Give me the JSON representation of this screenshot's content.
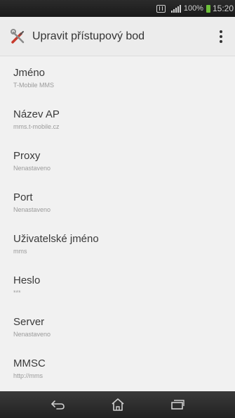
{
  "status_bar": {
    "battery_percent": "100%",
    "time": "15:20"
  },
  "action_bar": {
    "title": "Upravit přístupový bod"
  },
  "settings": [
    {
      "title": "Jméno",
      "value": "T-Mobile MMS"
    },
    {
      "title": "Název AP",
      "value": "mms.t-mobile.cz"
    },
    {
      "title": "Proxy",
      "value": "Nenastaveno"
    },
    {
      "title": "Port",
      "value": "Nenastaveno"
    },
    {
      "title": "Uživatelské jméno",
      "value": "mms"
    },
    {
      "title": "Heslo",
      "value": "***"
    },
    {
      "title": "Server",
      "value": "Nenastaveno"
    },
    {
      "title": "MMSC",
      "value": "http://mms"
    }
  ],
  "icons": {
    "status": [
      "nfc-icon",
      "signal-icon",
      "battery-icon"
    ],
    "action": [
      "settings-tools-icon",
      "overflow-menu-icon"
    ],
    "nav": [
      "back-icon",
      "home-icon",
      "recent-apps-icon"
    ]
  },
  "colors": {
    "battery": "#6dbf3a",
    "status_bar": "#222222",
    "nav_bar": "#2a2a2a"
  }
}
